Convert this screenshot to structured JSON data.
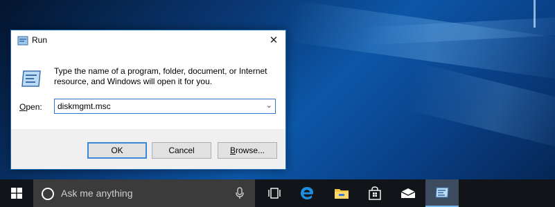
{
  "dialog": {
    "title": "Run",
    "close_glyph": "✕",
    "description": "Type the name of a program, folder, document, or Internet resource, and Windows will open it for you.",
    "open_label_accel": "O",
    "open_label_rest": "pen:",
    "open_value": "diskmgmt.msc",
    "ok_label": "OK",
    "cancel_label": "Cancel",
    "browse_accel": "B",
    "browse_rest": "rowse...",
    "icon": "run-icon",
    "dropdown_icon": "chevron-down-icon"
  },
  "taskbar": {
    "search_placeholder": "Ask me anything",
    "icons": [
      "windows-start-icon",
      "cortana-icon",
      "microphone-icon",
      "task-view-icon",
      "edge-icon",
      "file-explorer-icon",
      "store-icon",
      "mail-icon",
      "run-icon"
    ]
  },
  "colors": {
    "dialog_border": "#1f6fb5",
    "taskbar_bg": "#111418",
    "search_bg": "#3b3b3b",
    "accent": "#3b86d6"
  }
}
